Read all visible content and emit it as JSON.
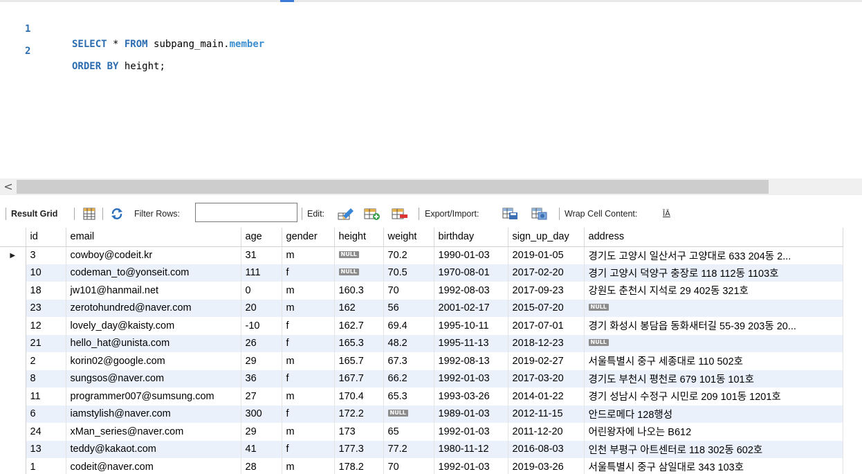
{
  "editor": {
    "lines": [
      {
        "num": "1",
        "tokens": [
          {
            "t": "SELECT",
            "c": "kw"
          },
          {
            "t": " * ",
            "c": "plain"
          },
          {
            "t": "FROM",
            "c": "kw"
          },
          {
            "t": " subpang_main.",
            "c": "plain"
          },
          {
            "t": "member",
            "c": "tblname"
          }
        ]
      },
      {
        "num": "2",
        "tokens": [
          {
            "t": "ORDER BY",
            "c": "kw"
          },
          {
            "t": " height;",
            "c": "plain"
          }
        ]
      }
    ]
  },
  "scrollbar": {
    "left_arrow": "<"
  },
  "toolbar": {
    "result_grid": "Result Grid",
    "filter_rows": "Filter Rows:",
    "filter_value": "",
    "edit": "Edit:",
    "export_import": "Export/Import:",
    "wrap_cell": "Wrap Cell Content:",
    "wrap_icon_glyph": "ĪĀ"
  },
  "grid": {
    "null_label": "NULL",
    "columns": [
      "id",
      "email",
      "age",
      "gender",
      "height",
      "weight",
      "birthday",
      "sign_up_day",
      "address"
    ],
    "rows": [
      [
        "3",
        "cowboy@codeit.kr",
        "31",
        "m",
        null,
        "70.2",
        "1990-01-03",
        "2019-01-05",
        "경기도 고양시 일산서구 고양대로 633 204동 2..."
      ],
      [
        "10",
        "codeman_to@yonseit.com",
        "111",
        "f",
        null,
        "70.5",
        "1970-08-01",
        "2017-02-20",
        "경기 고양시 덕양구 충장로 118 112동 1103호"
      ],
      [
        "18",
        "jw101@hanmail.net",
        "0",
        "m",
        "160.3",
        "70",
        "1992-08-03",
        "2017-09-23",
        "강원도 춘천시 지석로 29 402동 321호"
      ],
      [
        "23",
        "zerotohundred@naver.com",
        "20",
        "m",
        "162",
        "56",
        "2001-02-17",
        "2015-07-20",
        null
      ],
      [
        "12",
        "lovely_day@kaisty.com",
        "-10",
        "f",
        "162.7",
        "69.4",
        "1995-10-11",
        "2017-07-01",
        "경기 화성시 봉담읍 동화새터길 55-39 203동 20..."
      ],
      [
        "21",
        "hello_hat@unista.com",
        "26",
        "f",
        "165.3",
        "48.2",
        "1995-11-13",
        "2018-12-23",
        null
      ],
      [
        "2",
        "korin02@google.com",
        "29",
        "m",
        "165.7",
        "67.3",
        "1992-08-13",
        "2019-02-27",
        "서울특별시 중구 세종대로 110 502호"
      ],
      [
        "8",
        "sungsos@naver.com",
        "36",
        "f",
        "167.7",
        "66.2",
        "1992-01-03",
        "2017-03-20",
        "경기도 부천시 평천로 679 101동 101호"
      ],
      [
        "11",
        "programmer007@sumsung.com",
        "27",
        "m",
        "170.4",
        "65.3",
        "1993-03-26",
        "2014-01-22",
        "경기 성남시 수정구 시민로 209 101동 1201호"
      ],
      [
        "6",
        "iamstylish@naver.com",
        "300",
        "f",
        "172.2",
        null,
        "1989-01-03",
        "2012-11-15",
        "안드로메다 128행성"
      ],
      [
        "24",
        "xMan_series@naver.com",
        "29",
        "m",
        "173",
        "65",
        "1992-01-03",
        "2011-12-20",
        "어린왕자에 나오는 B612"
      ],
      [
        "13",
        "teddy@kakaot.com",
        "41",
        "f",
        "177.3",
        "77.2",
        "1980-11-12",
        "2016-08-03",
        "인천 부평구 아트센터로 118 302동 602호"
      ],
      [
        "1",
        "codeit@naver.com",
        "28",
        "m",
        "178.2",
        "70",
        "1992-01-03",
        "2019-03-26",
        "서울특별시 중구 삼일대로 343 103호"
      ]
    ],
    "current_row_marker": "▶"
  }
}
